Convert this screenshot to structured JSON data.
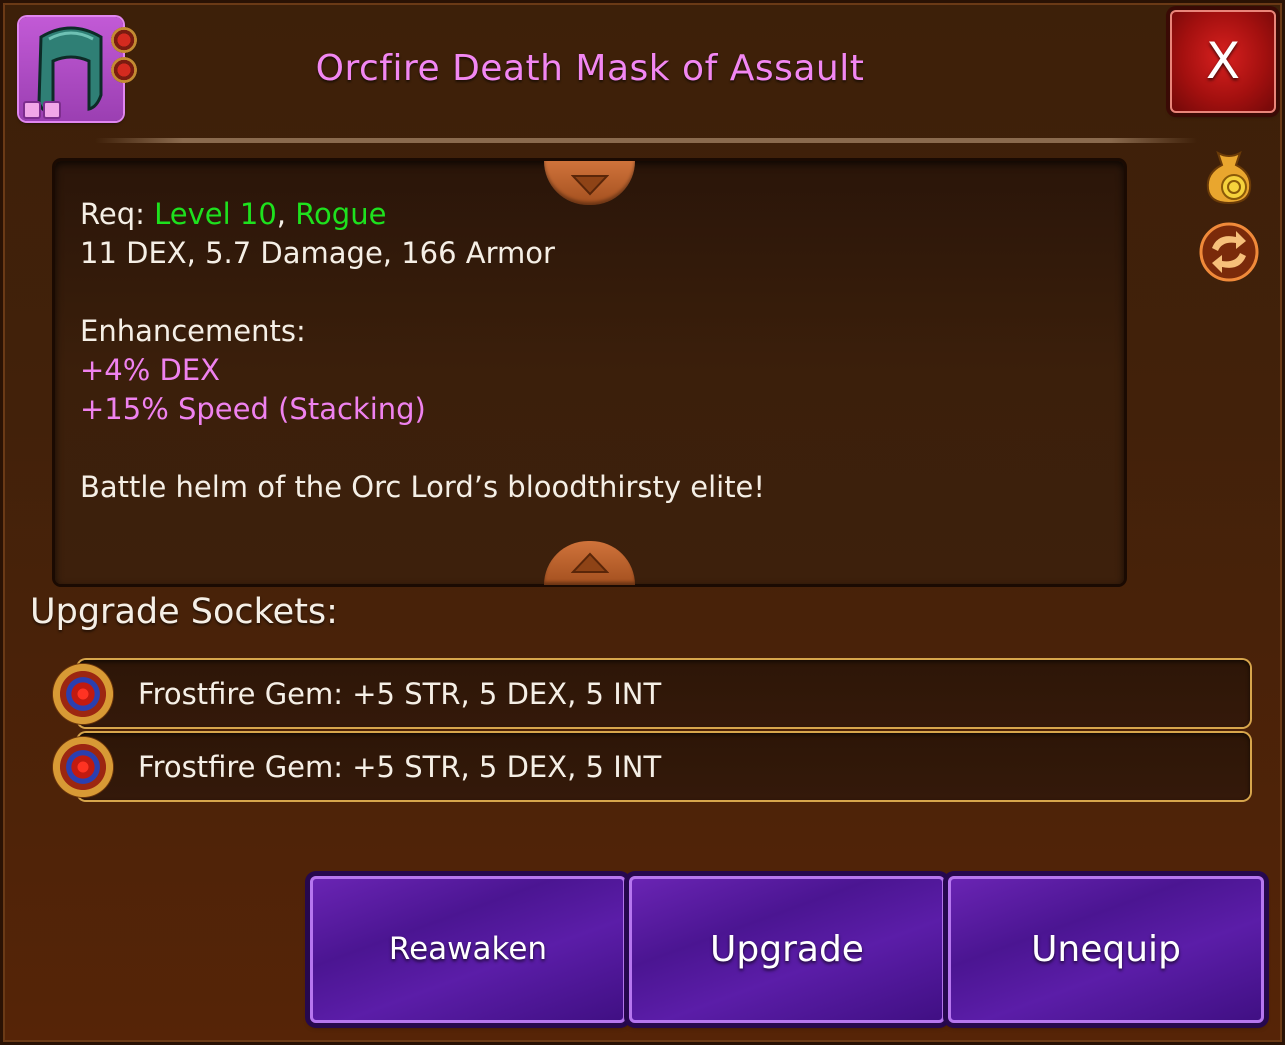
{
  "item": {
    "title": "Orcfire Death Mask of Assault",
    "icon": "helm-icon"
  },
  "close_label": "X",
  "side_icons": [
    "gold-bag-icon",
    "swap-icon"
  ],
  "info": {
    "req_prefix": "Req:",
    "req_level": "Level 10",
    "req_sep": ",",
    "req_class": "Rogue",
    "stats": "11 DEX, 5.7 Damage, 166 Armor",
    "enhancements_label": "Enhancements:",
    "enhancements": [
      "+4% DEX",
      "+15% Speed (Stacking)"
    ],
    "description": "Battle helm of the Orc Lord’s bloodthirsty elite!"
  },
  "sockets": {
    "title": "Upgrade Sockets:",
    "items": [
      {
        "text": "Frostfire Gem: +5 STR, 5 DEX, 5 INT",
        "icon": "frostfire-gem-icon"
      },
      {
        "text": "Frostfire Gem: +5 STR, 5 DEX, 5 INT",
        "icon": "frostfire-gem-icon"
      }
    ]
  },
  "buttons": {
    "reawaken": "Reawaken",
    "upgrade": "Upgrade",
    "unequip": "Unequip"
  },
  "colors": {
    "title": "#f287f2",
    "requirement": "#1ee11e",
    "enhancement": "#ef82ef",
    "button": "#4b1592",
    "close": "#c0161a"
  }
}
